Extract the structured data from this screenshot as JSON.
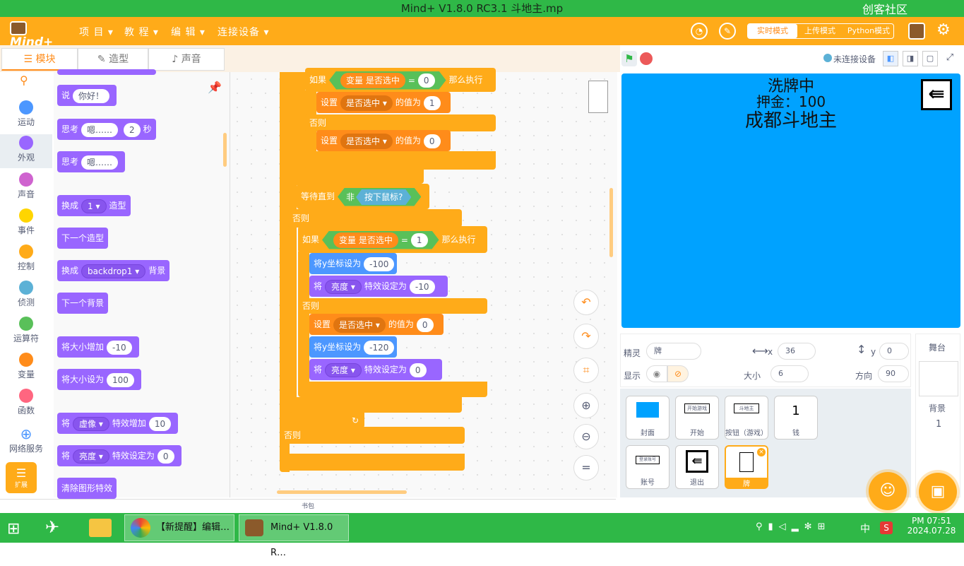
{
  "window": {
    "title": "Mind+ V1.8.0 RC3.1   斗地主.mp",
    "watermark": "创客社区"
  },
  "menubar": {
    "logo": "Mind+",
    "menus": [
      "项 目",
      "教 程",
      "编 辑",
      "连接设备"
    ],
    "modes": [
      "实时模式",
      "上传模式",
      "Python模式"
    ]
  },
  "tabs": [
    "模块",
    "造型",
    "声音"
  ],
  "categories": [
    {
      "label": "运动",
      "color": "#4c97ff"
    },
    {
      "label": "外观",
      "color": "#9966ff"
    },
    {
      "label": "声音",
      "color": "#cf63cf"
    },
    {
      "label": "事件",
      "color": "#ffd500"
    },
    {
      "label": "控制",
      "color": "#ffab19"
    },
    {
      "label": "侦测",
      "color": "#5cb1d6"
    },
    {
      "label": "运算符",
      "color": "#59c059"
    },
    {
      "label": "变量",
      "color": "#ff8c1a"
    },
    {
      "label": "函数",
      "color": "#ff6680"
    }
  ],
  "cat_extra": {
    "network": "网络服务",
    "ext": "扩展"
  },
  "palette": {
    "say": "说",
    "say_val": "你好！",
    "think_secs": "思考",
    "think_val": "嗯……",
    "secs": "2",
    "secs_unit": "秒",
    "think": "思考",
    "think_val2": "嗯……",
    "switch_costume": "换成",
    "costume_val": "1",
    "costume_unit": "造型",
    "next_costume": "下一个造型",
    "switch_bg": "换成",
    "bg_val": "backdrop1",
    "bg_unit": "背景",
    "next_bg": "下一个背景",
    "change_size": "将大小增加",
    "change_size_val": "-10",
    "set_size": "将大小设为",
    "set_size_val": "100",
    "change_effect_pre": "将",
    "effect_val": "虚像",
    "change_effect_mid": "特效增加",
    "change_effect_num": "10",
    "set_effect_pre": "将",
    "effect_val2": "亮度",
    "set_effect_mid": "特效设定为",
    "set_effect_num": "0",
    "clear_effects": "清除图形特效"
  },
  "script": {
    "if1": "如果",
    "var_name": "变量 是否选中",
    "eq": "=",
    "v0": "0",
    "then": "那么执行",
    "set": "设置",
    "dd_var": "是否选中",
    "to": "的值为",
    "v1": "1",
    "else": "否则",
    "v0b": "0",
    "wait": "等待直到",
    "not": "非",
    "mouse": "按下鼠标?",
    "else2": "否则",
    "if2": "如果",
    "var_name2": "变量 是否选中",
    "eq2": "=",
    "v12": "1",
    "then2": "那么执行",
    "sety": "将y坐标设为",
    "y1": "-100",
    "eff_pre": "将",
    "eff": "亮度",
    "eff_to": "特效设定为",
    "eff_v1": "-10",
    "else3": "否则",
    "set2": "设置",
    "dd_var2": "是否选中",
    "to2": "的值为",
    "v0c": "0",
    "sety2": "将y坐标设为",
    "y2": "-120",
    "eff_pre2": "将",
    "eff2": "亮度",
    "eff_to2": "特效设定为",
    "eff_v2": "0",
    "else4": "否则",
    "loop": "↻"
  },
  "stage_head": {
    "device": "未连接设备"
  },
  "stage": {
    "line1": "洗牌中",
    "line2": "押金：100",
    "line3": "成都斗地主"
  },
  "sprite_info": {
    "sprite_label": "精灵",
    "sprite_name": "牌",
    "x_label": "x",
    "x": "36",
    "y_label": "y",
    "y": "0",
    "show_label": "显示",
    "size_label": "大小",
    "size": "6",
    "dir_label": "方向",
    "dir": "90"
  },
  "sprites": [
    "封面",
    "开始",
    "按钮（游戏）",
    "钱",
    "账号",
    "退出",
    "牌"
  ],
  "sprite_thumbs": {
    "start": "开始游戏",
    "button": "斗地主",
    "money": "1",
    "account": "登录账号"
  },
  "stage_panel": {
    "title": "舞台",
    "bg_label": "背景",
    "bg_count": "1"
  },
  "bag": "书包",
  "taskbar": {
    "item1": "【新提醒】编辑…",
    "item2": "Mind+ V1.8.0 R…",
    "ime": "中",
    "time": "PM 07:51",
    "date": "2024.07.28"
  }
}
